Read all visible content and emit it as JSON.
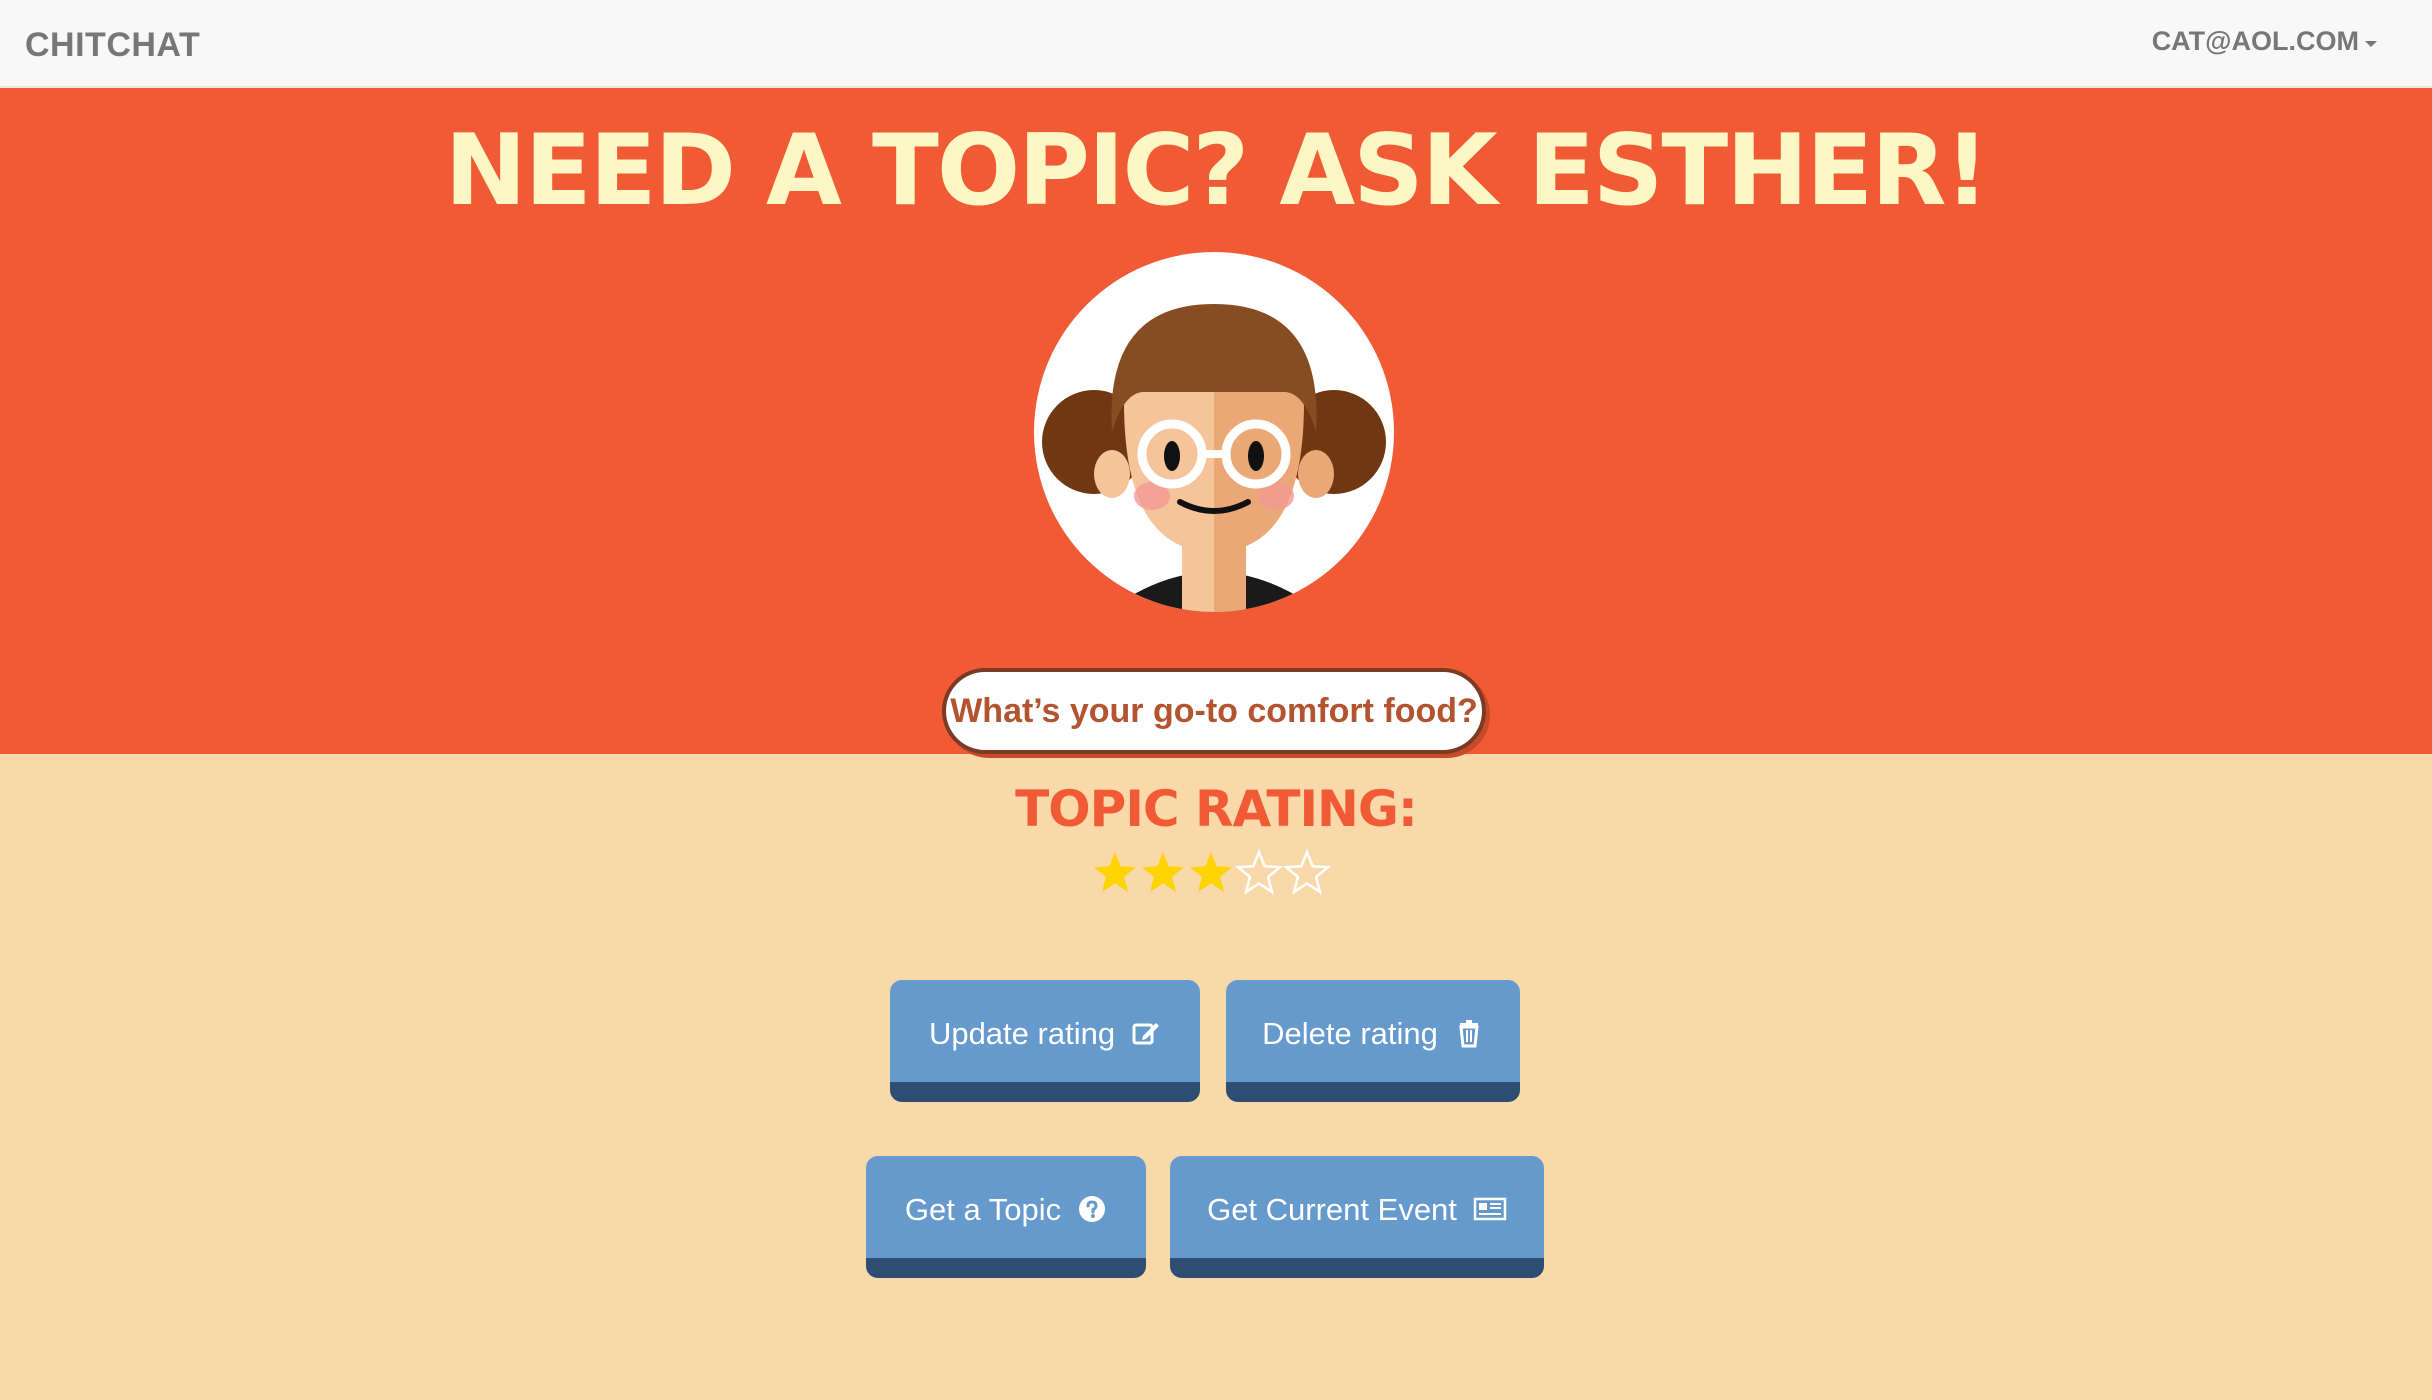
{
  "navbar": {
    "brand": "CHITCHAT",
    "user_email": "CAT@AOL.COM"
  },
  "hero": {
    "title": "Need a Topic? Ask Esther!",
    "avatar_icon": "esther-avatar",
    "topic_text": "What’s your go-to comfort food?"
  },
  "rating": {
    "title": "Topic Rating:",
    "value": 3,
    "max": 5,
    "filled_color": "#ffd400",
    "empty_color": "#ffffff"
  },
  "buttons": {
    "update_label": "Update rating",
    "update_icon": "edit-icon",
    "delete_label": "Delete rating",
    "delete_icon": "trash-icon",
    "topic_label": "Get a Topic",
    "topic_icon": "question-circle-icon",
    "event_label": "Get Current Event",
    "event_icon": "newspaper-icon"
  },
  "colors": {
    "hero_bg": "#f05a34",
    "page_bg": "#f9d8aa",
    "title_color": "#fdf7c5",
    "button_bg": "#6699cc",
    "button_shadow": "#2d4d72"
  }
}
